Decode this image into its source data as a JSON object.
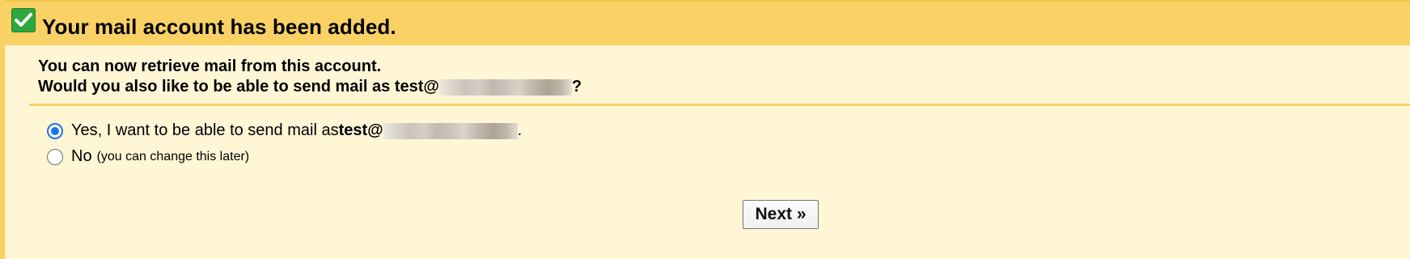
{
  "header": {
    "icon": "check-icon",
    "title": "Your mail account has been added."
  },
  "intro": {
    "line1": "You can now retrieve mail from this account.",
    "line2_prefix": "Would you also like to be able to send mail as test@",
    "line2_suffix": "?"
  },
  "options": {
    "yes": {
      "label_prefix": "Yes, I want to be able to send mail as ",
      "email_prefix": "test@",
      "suffix": ".",
      "checked": true
    },
    "no": {
      "label": "No",
      "note": "(you can change this later)",
      "checked": false
    }
  },
  "actions": {
    "next_label": "Next »"
  },
  "colors": {
    "header_bg": "#fad165",
    "panel_bg": "#fff6d6",
    "accent": "#f9d162",
    "radio_selected": "#1a73e8",
    "success_icon": "#2fa73e"
  }
}
